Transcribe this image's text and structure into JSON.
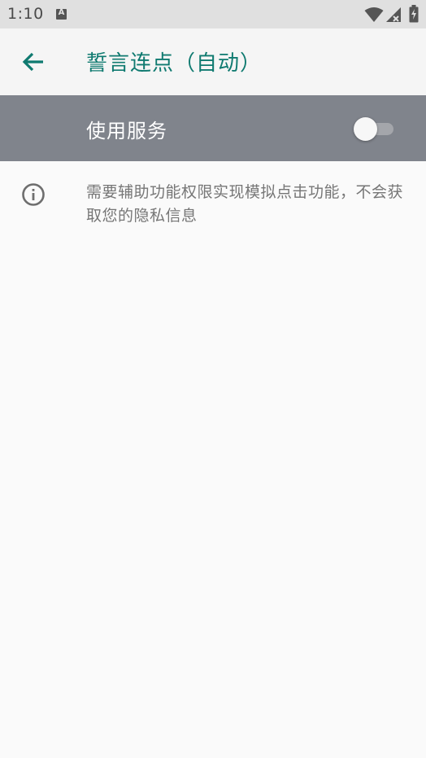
{
  "status_bar": {
    "time": "1:10",
    "notification_icon": "a-icon",
    "icons": [
      "wifi-icon",
      "signal-icon",
      "battery-icon"
    ]
  },
  "app_bar": {
    "back_icon": "arrow-left-icon",
    "title": "誓言连点（自动）",
    "accent_color": "#0f7a70"
  },
  "service": {
    "label": "使用服务",
    "toggle_on": false,
    "row_color": "#80848c"
  },
  "info": {
    "icon": "info-icon",
    "text": "需要辅助功能权限实现模拟点击功能，不会获取您的隐私信息"
  }
}
